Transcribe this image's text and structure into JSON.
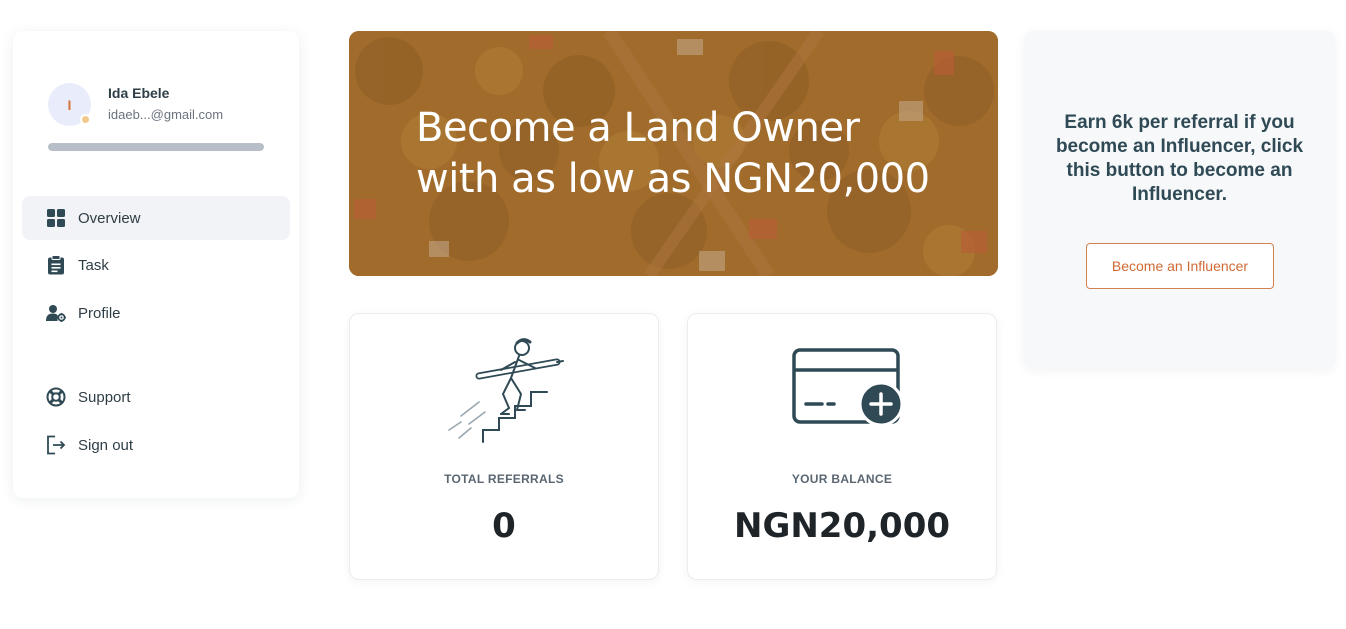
{
  "user": {
    "initial": "I",
    "name": "Ida Ebele",
    "email": "idaeb...@gmail.com",
    "profile_progress": 1.0
  },
  "nav": {
    "overview": "Overview",
    "task": "Task",
    "profile": "Profile",
    "support": "Support",
    "signout": "Sign out"
  },
  "banner": {
    "line1": "Become a Land Owner",
    "line2": "with as low as NGN20,000"
  },
  "influencer": {
    "text": "Earn 6k per referral if you become an Influencer, click this button to become an Influencer.",
    "button": "Become an Influencer"
  },
  "stats": {
    "referrals_label": "TOTAL REFERRALS",
    "referrals_value": "0",
    "balance_label": "YOUR BALANCE",
    "balance_value": "NGN20,000"
  },
  "colors": {
    "accent": "#d06a34",
    "primary_text": "#2f3e46",
    "icon_dark": "#2f4a55",
    "active_nav_bg": "#f1f3f7"
  },
  "icons": {
    "overview": "grid-icon",
    "task": "clipboard-icon",
    "profile": "user-gear-icon",
    "support": "lifebuoy-icon",
    "signout": "sign-out-icon",
    "balance": "card-add-icon"
  }
}
